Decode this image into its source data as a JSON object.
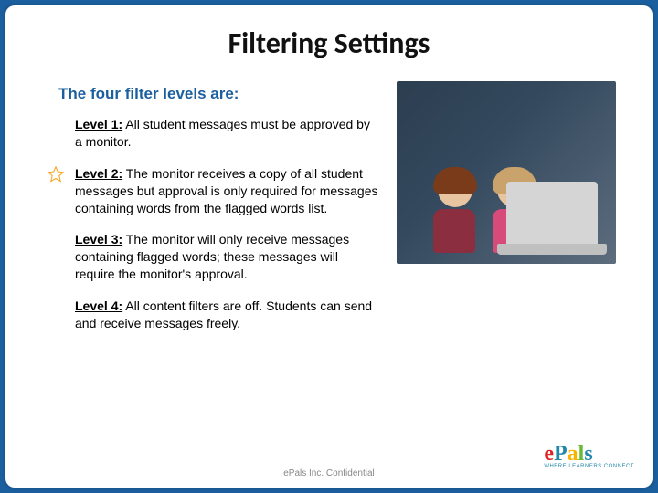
{
  "title": "Filtering Settings",
  "subhead": "The four filter levels are:",
  "levels": [
    {
      "label": "Level 1:",
      "text": "All student messages must be approved by a monitor.",
      "starred": false
    },
    {
      "label": "Level 2:",
      "text": "The monitor receives a copy of all student messages but approval is only required for messages containing words from the flagged words list.",
      "starred": true
    },
    {
      "label": "Level 3:",
      "text": "The monitor will only receive messages containing flagged words; these messages will require the monitor's approval.",
      "starred": false
    },
    {
      "label": "Level 4:",
      "text": "All content filters are off. Students can send and receive messages freely.",
      "starred": false
    }
  ],
  "footer": "ePals Inc. Confidential",
  "logo": {
    "brand": "ePals",
    "tagline": "WHERE LEARNERS CONNECT"
  }
}
